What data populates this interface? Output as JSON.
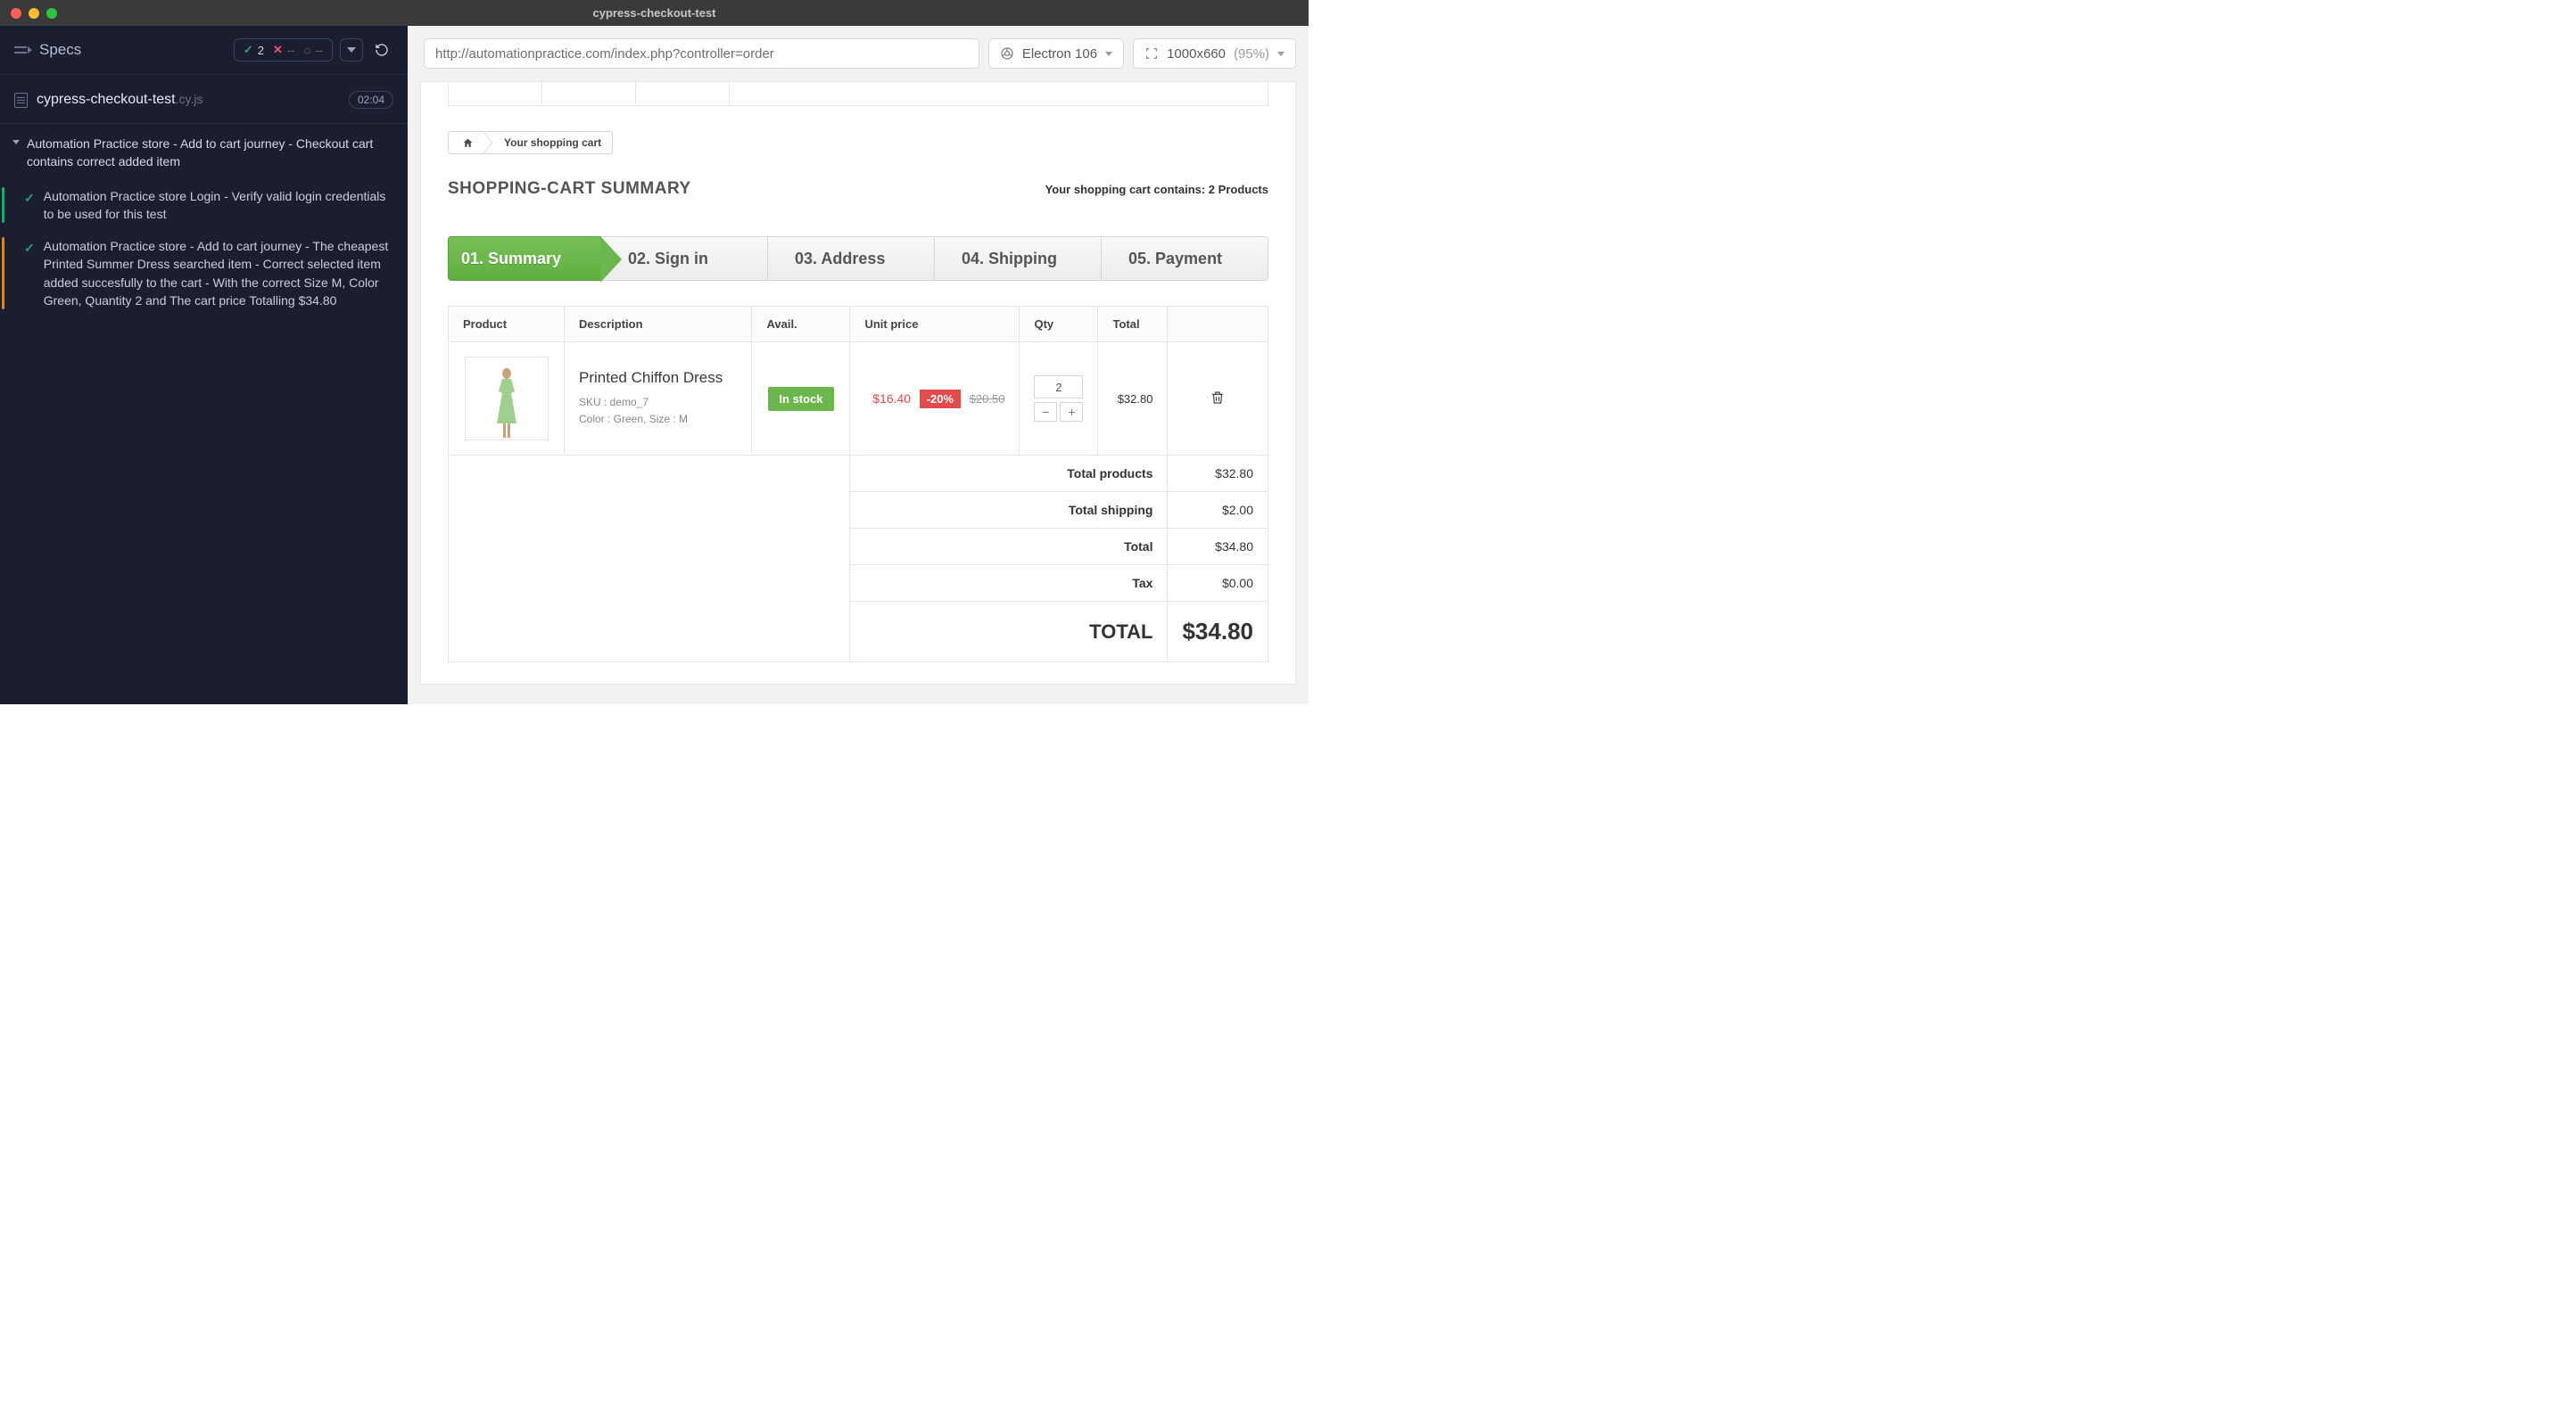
{
  "window": {
    "title": "cypress-checkout-test"
  },
  "sidebar": {
    "specs_label": "Specs",
    "pass_count": "2",
    "fail_count": "--",
    "pending_count": "--",
    "file_name": "cypress-checkout-test",
    "file_ext": ".cy.js",
    "elapsed": "02:04",
    "suite_title": "Automation Practice store - Add to cart journey - Checkout cart contains correct added item",
    "tests": [
      "Automation Practice store Login - Verify valid login credentials to be used for this test",
      "Automation Practice store - Add to cart journey - The cheapest Printed Summer Dress searched item - Correct selected item added succesfully to the cart - With the correct Size M, Color Green, Quantity 2 and The cart price Totalling $34.80"
    ]
  },
  "toolbar": {
    "url": "http://automationpractice.com/index.php?controller=order",
    "browser": "Electron 106",
    "viewport": "1000x660",
    "scale": "(95%)"
  },
  "breadcrumb": {
    "current": "Your shopping cart"
  },
  "heading": {
    "title": "SHOPPING-CART SUMMARY",
    "subtitle": "Your shopping cart contains: 2 Products"
  },
  "steps": [
    "01. Summary",
    "02. Sign in",
    "03. Address",
    "04. Shipping",
    "05. Payment"
  ],
  "table": {
    "headers": {
      "product": "Product",
      "description": "Description",
      "avail": "Avail.",
      "unit": "Unit price",
      "qty": "Qty",
      "total": "Total"
    },
    "row": {
      "name": "Printed Chiffon Dress",
      "sku": "SKU : demo_7",
      "attrs": "Color : Green, Size : M",
      "stock": "In stock",
      "price_now": "$16.40",
      "discount": "-20%",
      "price_old": "$20.50",
      "qty": "2",
      "line_total": "$32.80"
    },
    "totals": {
      "products_lbl": "Total products",
      "products_val": "$32.80",
      "shipping_lbl": "Total shipping",
      "shipping_val": "$2.00",
      "subtotal_lbl": "Total",
      "subtotal_val": "$34.80",
      "tax_lbl": "Tax",
      "tax_val": "$0.00",
      "grand_lbl": "TOTAL",
      "grand_val": "$34.80"
    }
  }
}
